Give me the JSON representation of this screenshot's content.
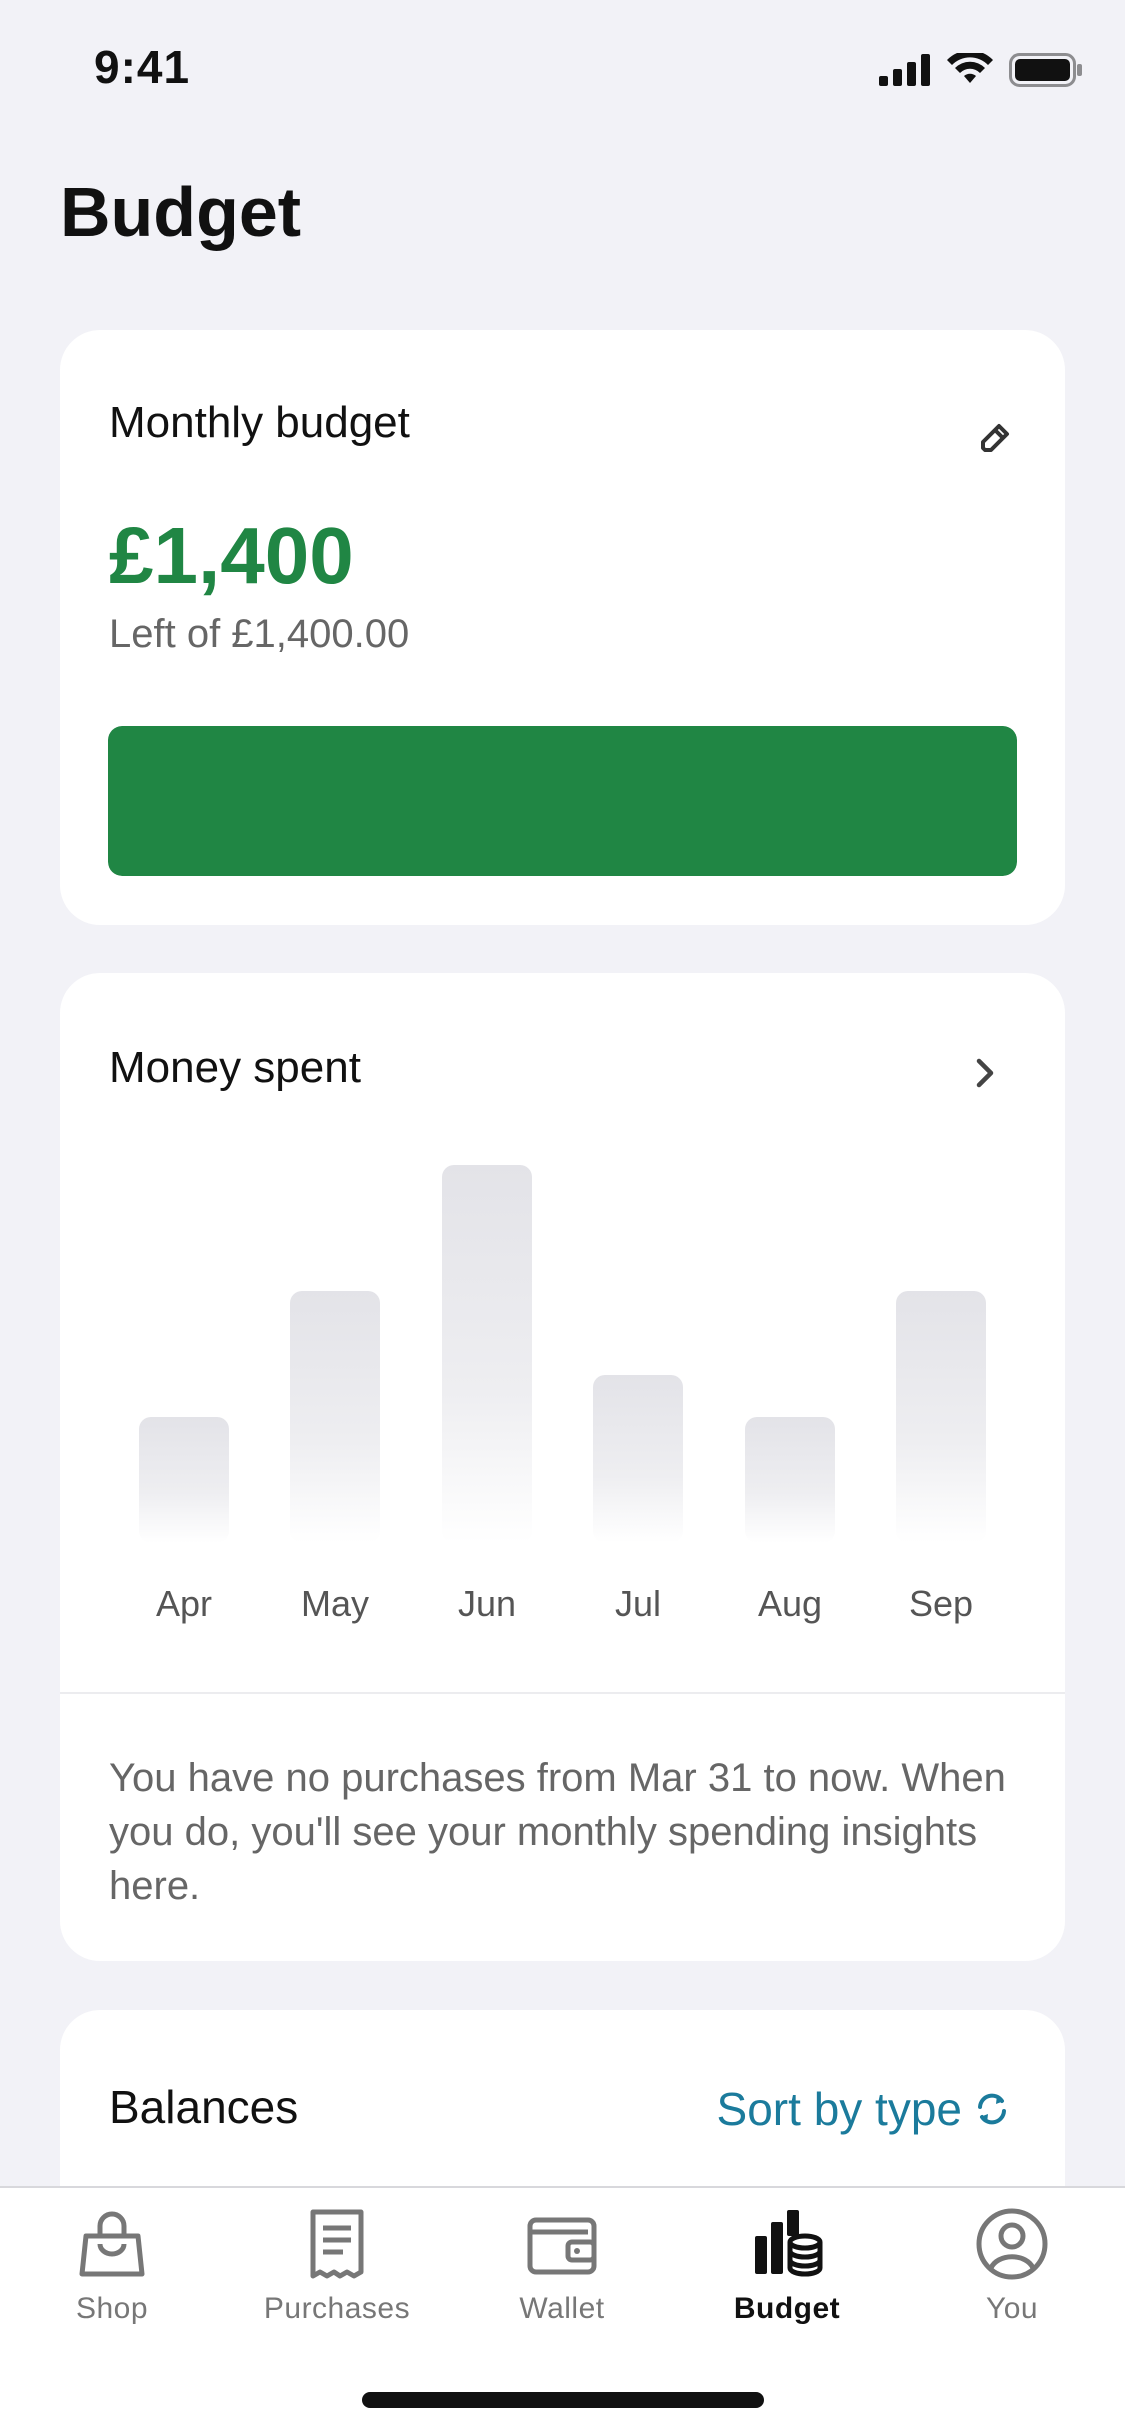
{
  "status_bar": {
    "time": "9:41"
  },
  "page": {
    "title": "Budget"
  },
  "budget_card": {
    "title": "Monthly budget",
    "amount": "£1,400",
    "subtitle": "Left of £1,400.00",
    "remaining_fraction": 1.0,
    "accent_color": "#208644"
  },
  "spent_card": {
    "title": "Money spent",
    "message": "You have no purchases from Mar 31 to now. When you do, you'll see your monthly spending insights here."
  },
  "chart_data": {
    "type": "bar",
    "categories": [
      "Apr",
      "May",
      "Jun",
      "Jul",
      "Aug",
      "Sep"
    ],
    "values": [
      3,
      6,
      9,
      4,
      3,
      6
    ],
    "ylim": [
      0,
      10
    ],
    "grid": false
  },
  "balances_card": {
    "title": "Balances",
    "sort_label": "Sort by type",
    "sort_color": "#1b7b9c"
  },
  "tab_bar": {
    "tabs": [
      {
        "label": "Shop",
        "icon": "shopping-bag-icon"
      },
      {
        "label": "Purchases",
        "icon": "receipt-icon"
      },
      {
        "label": "Wallet",
        "icon": "wallet-icon"
      },
      {
        "label": "Budget",
        "icon": "budget-chart-icon",
        "active": true
      },
      {
        "label": "You",
        "icon": "user-profile-icon"
      }
    ]
  }
}
